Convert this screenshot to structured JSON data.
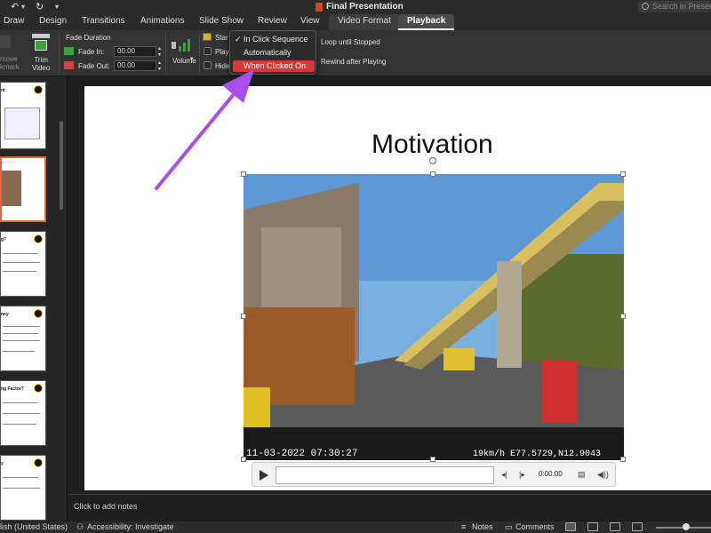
{
  "window": {
    "title": "Final Presentation"
  },
  "search": {
    "placeholder": "Search in Presentation"
  },
  "tabs": [
    "Draw",
    "Design",
    "Transitions",
    "Animations",
    "Slide Show",
    "Review",
    "View",
    "Video Format",
    "Playback"
  ],
  "active_tab": "Playback",
  "ribbon": {
    "remove_bookmark": "move\nkmark",
    "trim_video": "Trim\nVideo",
    "fade_duration_label": "Fade Duration",
    "fade_in_label": "Fade In:",
    "fade_in_value": "00.00",
    "fade_out_label": "Fade Out:",
    "fade_out_value": "00.00",
    "volume_label": "Volume",
    "start_label": "Star",
    "play_full_label": "Play",
    "hide_label": "Hide",
    "loop_label": "Loop until Stopped",
    "rewind_label": "Rewind after Playing"
  },
  "start_dropdown": {
    "options": [
      "In Click Sequence",
      "Automatically",
      "When Clicked On"
    ],
    "checked_index": 0,
    "highlighted_index": 2
  },
  "thumbnails": [
    {
      "title": "nt"
    },
    {
      "title": ""
    },
    {
      "title": "g?"
    },
    {
      "title": "ney"
    },
    {
      "title": "ng Factor?"
    },
    {
      "title": "y"
    }
  ],
  "slide": {
    "title": "Motivation",
    "video_overlay_left": "11-03-2022 07:30:27",
    "video_overlay_right": "19km/h E77.5729,N12.9043",
    "player_time": "0:00.00"
  },
  "notes": {
    "placeholder": "Click to add notes"
  },
  "status": {
    "language": "lish (United States)",
    "accessibility": "Accessibility: Investigate",
    "notes_button": "Notes",
    "comments_button": "Comments"
  },
  "colors": {
    "accent_red": "#d23a3a",
    "arrow_purple": "#a84ef0",
    "thumb_active_border": "#e0663d"
  }
}
